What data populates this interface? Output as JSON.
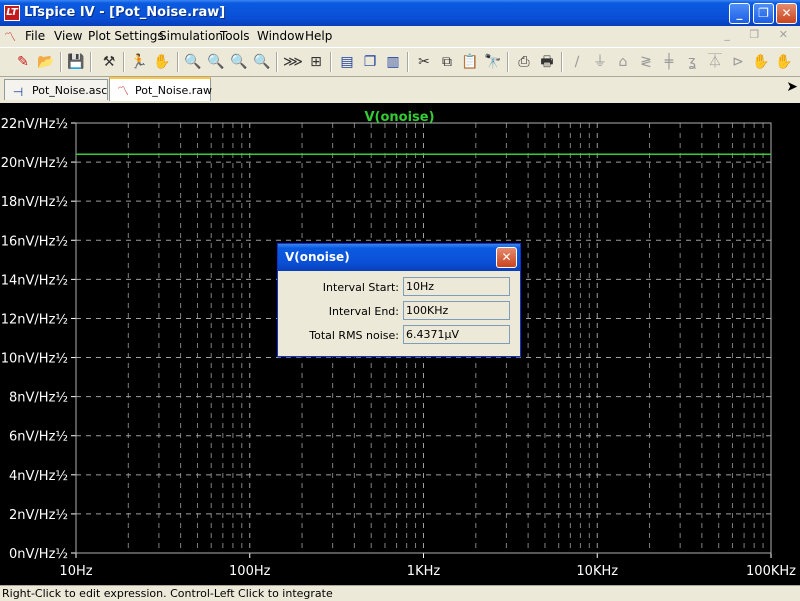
{
  "window": {
    "app_icon_text": "LT",
    "title": "LTspice IV - [Pot_Noise.raw]",
    "minimize": "_",
    "restore": "❐",
    "close": "✕"
  },
  "menu": {
    "items": [
      "File",
      "View",
      "Plot Settings",
      "Simulation",
      "Tools",
      "Window",
      "Help"
    ],
    "mdi_buttons": "_ ❐ ✕"
  },
  "toolbar": {
    "icons": [
      "new-schematic-icon",
      "open-icon",
      "save-icon",
      "control-panel-icon",
      "run-icon",
      "halt-icon",
      "zoom-in-icon",
      "zoom-out-icon",
      "zoom-fit-icon",
      "zoom-cancel-icon",
      "autorange-icon",
      "add-trace-icon",
      "tile-horizontal-icon",
      "cascade-icon",
      "tile-vertical-icon",
      "cut-icon",
      "copy-icon",
      "paste-icon",
      "find-icon",
      "print-setup-icon",
      "print-icon",
      "draw-wire-icon",
      "ground-icon",
      "label-net-icon",
      "resistor-icon",
      "capacitor-icon",
      "inductor-icon",
      "diode-icon",
      "component-icon",
      "move-icon",
      "drag-icon"
    ]
  },
  "tabs": [
    {
      "label": "Pot_Noise.asc",
      "icon": "schematic-icon",
      "active": false
    },
    {
      "label": "Pot_Noise.raw",
      "icon": "waveform-icon",
      "active": true
    }
  ],
  "plot": {
    "trace_label": "V(onoise)",
    "trace_color": "#33cc33"
  },
  "chart_data": {
    "type": "line",
    "title": "V(onoise)",
    "x_scale": "log",
    "xlim": [
      10,
      100000
    ],
    "ylim": [
      0,
      22
    ],
    "x_ticks": [
      10,
      100,
      1000,
      10000,
      100000
    ],
    "x_tick_labels": [
      "10Hz",
      "100Hz",
      "1KHz",
      "10KHz",
      "100KHz"
    ],
    "y_ticks": [
      0,
      2,
      4,
      6,
      8,
      10,
      12,
      14,
      16,
      18,
      20,
      22
    ],
    "y_tick_labels": [
      "0nV/Hz½",
      "2nV/Hz½",
      "4nV/Hz½",
      "6nV/Hz½",
      "8nV/Hz½",
      "10nV/Hz½",
      "12nV/Hz½",
      "14nV/Hz½",
      "16nV/Hz½",
      "18nV/Hz½",
      "20nV/Hz½",
      "22nV/Hz½"
    ],
    "grid": true,
    "series": [
      {
        "name": "V(onoise)",
        "x": [
          10,
          100000
        ],
        "y": [
          20.4,
          20.4
        ],
        "color": "#33cc33"
      }
    ]
  },
  "dialog": {
    "title": "V(onoise)",
    "close": "✕",
    "rows": [
      {
        "label": "Interval Start:",
        "value": "10Hz"
      },
      {
        "label": "Interval End:",
        "value": "100KHz"
      },
      {
        "label": "Total RMS noise:",
        "value": "6.4371µV"
      }
    ]
  },
  "status": {
    "text": "Right-Click to edit expression. Control-Left Click to integrate"
  }
}
